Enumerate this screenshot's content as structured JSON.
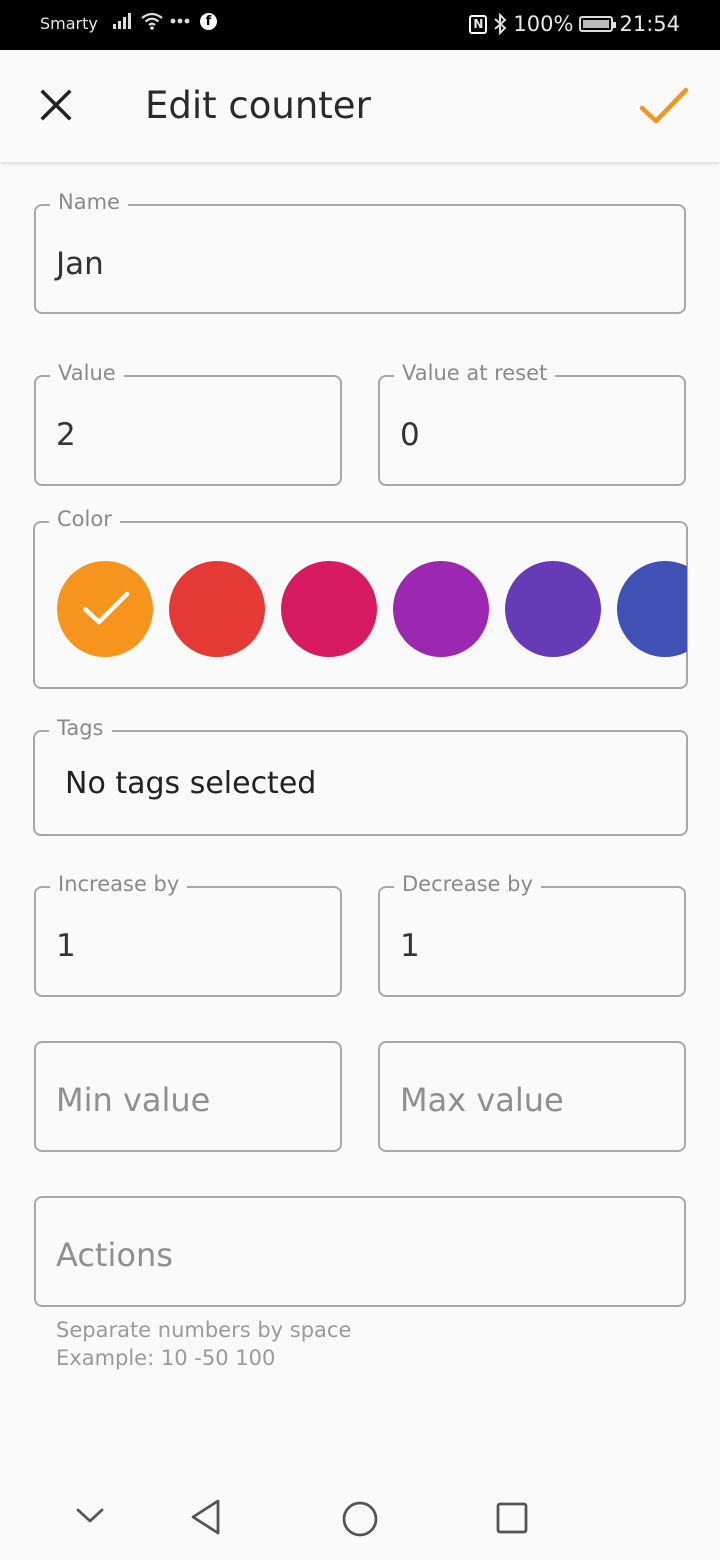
{
  "status_bar": {
    "carrier": "Smarty",
    "battery_percent": "100%",
    "time": "21:54"
  },
  "app_bar": {
    "title": "Edit counter"
  },
  "form": {
    "name": {
      "label": "Name",
      "value": "Jan"
    },
    "value": {
      "label": "Value",
      "value": "2"
    },
    "value_at_reset": {
      "label": "Value at reset",
      "value": "0"
    },
    "color": {
      "label": "Color",
      "swatches": [
        "#f7941d",
        "#e53935",
        "#d81b60",
        "#9c27b0",
        "#673ab7",
        "#3f51b5"
      ],
      "selected_index": 0
    },
    "tags": {
      "label": "Tags",
      "value": "No tags selected"
    },
    "increase_by": {
      "label": "Increase by",
      "value": "1"
    },
    "decrease_by": {
      "label": "Decrease by",
      "value": "1"
    },
    "min_value": {
      "placeholder": "Min value"
    },
    "max_value": {
      "placeholder": "Max value"
    },
    "actions": {
      "placeholder": "Actions",
      "helper_line1": "Separate numbers by space",
      "helper_line2": "Example: 10 -50 100"
    }
  },
  "colors": {
    "accent": "#f7941d",
    "background": "#fafafa"
  },
  "icons": {
    "close": "close-icon",
    "confirm": "check-icon",
    "nav_down": "chevron-down-icon",
    "nav_back": "back-triangle-icon",
    "nav_home": "home-circle-icon",
    "nav_recents": "recents-square-icon"
  }
}
